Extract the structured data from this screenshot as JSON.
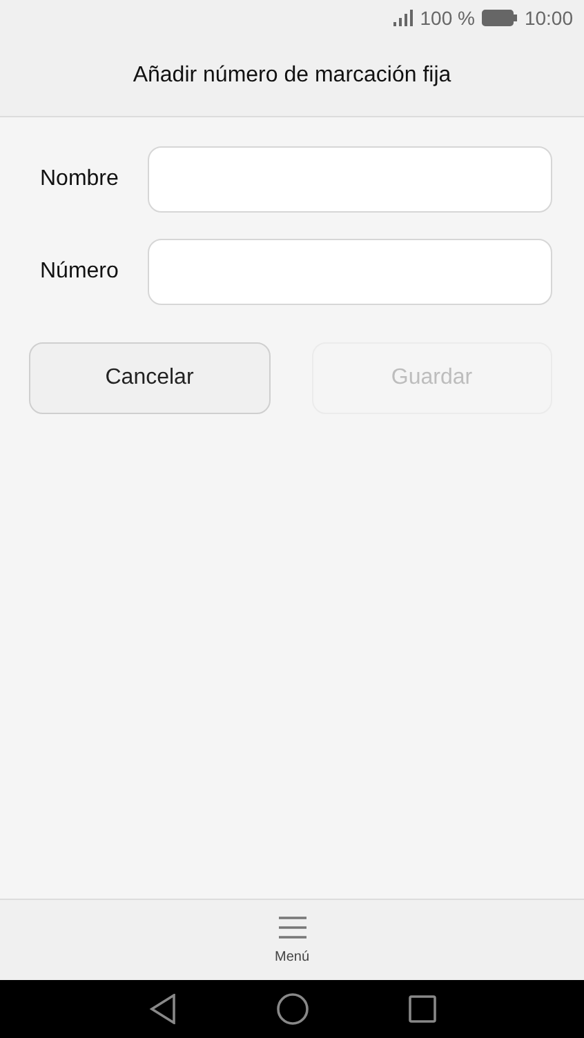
{
  "status_bar": {
    "battery_text": "100 %",
    "time": "10:00"
  },
  "title": "Añadir número de marcación fija",
  "fields": [
    {
      "label": "Nombre"
    },
    {
      "label": "Número"
    }
  ],
  "buttons": [
    {
      "label": "Cancelar",
      "disabled": false
    },
    {
      "label": "Guardar",
      "disabled": true
    }
  ],
  "bottom_menu": {
    "label": "Menú"
  }
}
